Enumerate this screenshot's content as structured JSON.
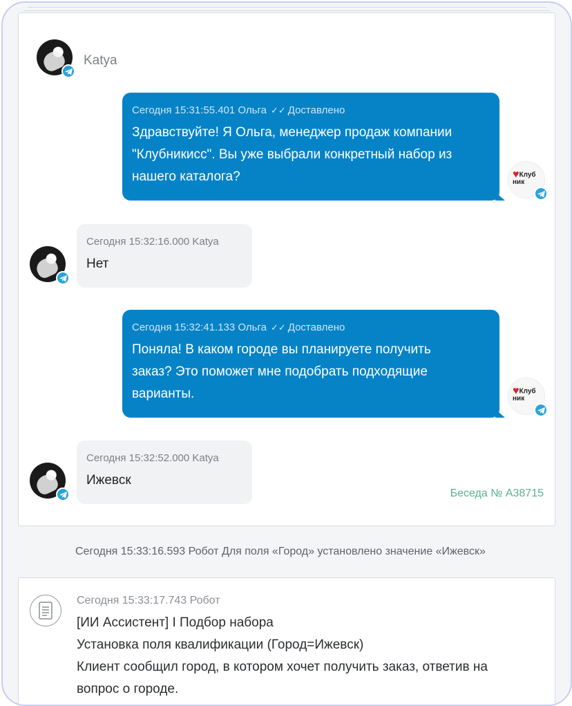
{
  "conversation": {
    "contact_name": "Katya",
    "messages": [
      {
        "direction": "outgoing",
        "meta": "Сегодня 15:31:55.401 Ольга",
        "status": "Доставлено",
        "lines": [
          "Здравствуйте! Я Ольга, менеджер продаж компании",
          "\"Клубникисс\". Вы уже выбрали конкретный набор из",
          "нашего каталога?"
        ]
      },
      {
        "direction": "incoming",
        "meta": "Сегодня 15:32:16.000 Katya",
        "lines": [
          "Нет"
        ]
      },
      {
        "direction": "outgoing",
        "meta": "Сегодня 15:32:41.133 Ольга",
        "status": "Доставлено",
        "lines": [
          "Поняла! В каком городе вы планируете получить",
          "заказ? Это поможет мне подобрать подходящие",
          "варианты."
        ]
      },
      {
        "direction": "incoming",
        "meta": "Сегодня 15:32:52.000 Katya",
        "lines": [
          "Ижевск"
        ]
      }
    ],
    "conversation_link": "Беседа № А38715",
    "brand_logo_text": "Клуб ник",
    "check_glyph": "✓✓"
  },
  "system_event": {
    "text": "Сегодня 15:33:16.593 Робот Для поля «Город» установлено значение «Ижевск»"
  },
  "robot_note": {
    "meta": "Сегодня 15:33:17.743 Робот",
    "lines": [
      "[ИИ Ассистент] I Подбор набора",
      "Установка поля квалификации (Город=Ижевск)",
      "Клиент сообщил город, в котором хочет получить заказ, ответив на",
      "вопрос о городе."
    ]
  },
  "colors": {
    "outgoing_bubble": "#0683c7",
    "incoming_bubble": "#f1f2f4",
    "telegram_badge": "#2aa3dc",
    "conversation_link": "#55b38e",
    "frame_border": "#c9ccf3"
  },
  "icons": [
    "telegram-icon",
    "double-check-icon",
    "document-icon"
  ]
}
